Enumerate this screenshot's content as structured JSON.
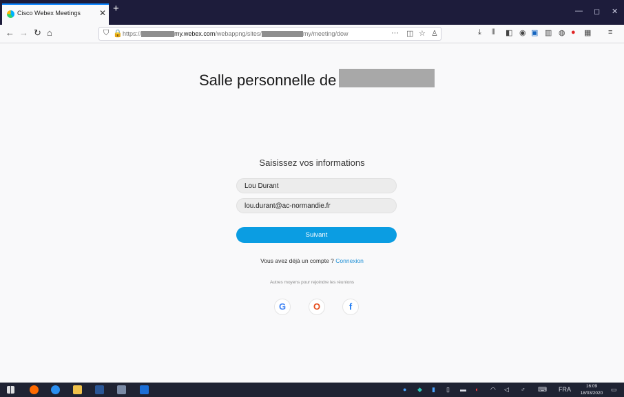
{
  "browser": {
    "tab": {
      "title": "Cisco Webex Meetings"
    },
    "window_controls": {
      "minimize": "—",
      "maximize": "◻",
      "close": "✕"
    },
    "url": {
      "prefix": "https://",
      "segment_a": "my.webex.com",
      "segment_b": "/webappng/sites/",
      "segment_c": "my/meeting/dow"
    },
    "colors": {
      "tabbar": "#1d1c3b",
      "accent": "#0a84ff"
    }
  },
  "page": {
    "room_title": "Salle personnelle de",
    "heading": "Saisissez vos informations",
    "name_value": "Lou Durant",
    "email_value": "lou.durant@ac-normandie.fr",
    "next_label": "Suivant",
    "account_question": "Vous avez déjà un compte ?",
    "account_link": "Connexion",
    "alt_methods": "Autres moyens pour rejoindre les réunions",
    "social": {
      "google": "G",
      "office": "O",
      "facebook": "f"
    },
    "colors": {
      "primary_button": "#0b9de2",
      "link": "#1d8fd6"
    }
  },
  "taskbar": {
    "language": "FRA",
    "time": "16:09",
    "date": "18/03/2020"
  }
}
